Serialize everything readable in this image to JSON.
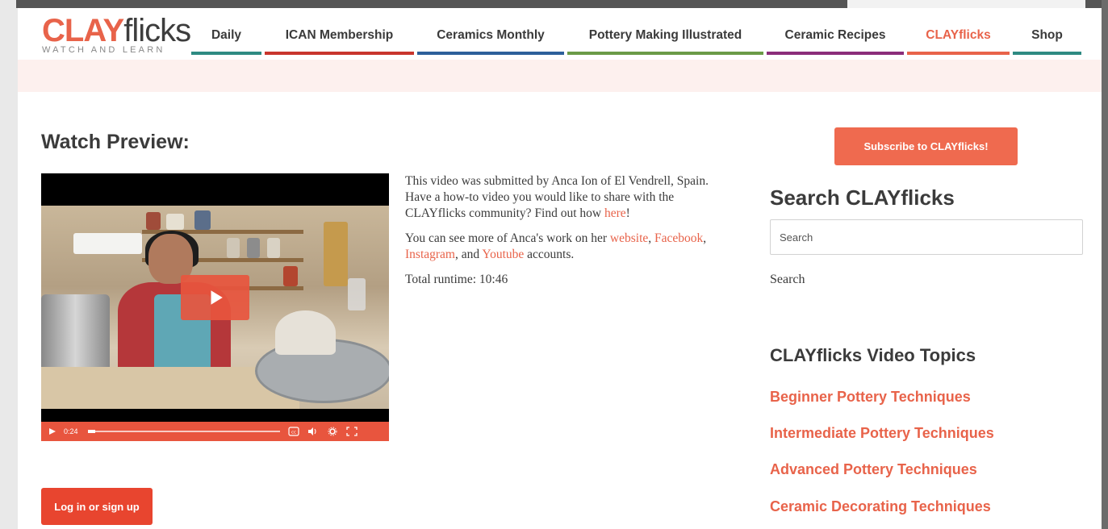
{
  "brand": {
    "logo_clay": "CLAY",
    "logo_flicks": "flicks",
    "logo_tagline": "WATCH AND LEARN",
    "accent": "#e8634a"
  },
  "nav": {
    "items": [
      {
        "label": "Daily",
        "color": "#2e8a82",
        "active": false
      },
      {
        "label": "ICAN Membership",
        "color": "#c8352c",
        "active": false
      },
      {
        "label": "Ceramics Monthly",
        "color": "#2d5f9a",
        "active": false
      },
      {
        "label": "Pottery Making Illustrated",
        "color": "#6b9a47",
        "active": false
      },
      {
        "label": "Ceramic Recipes",
        "color": "#8b2d7a",
        "active": false
      },
      {
        "label": "CLAYflicks",
        "color": "#e8634a",
        "active": true
      },
      {
        "label": "Shop",
        "color": "#2e8a82",
        "active": false
      }
    ]
  },
  "main": {
    "watch_title": "Watch Preview:",
    "video": {
      "current_time": "0:24",
      "progress_fraction": 0.04,
      "icons": [
        "play-icon",
        "closed-captions-icon",
        "volume-icon",
        "settings-icon",
        "fullscreen-icon"
      ]
    },
    "description": {
      "p1_text": "This video was submitted by Anca Ion of El Vendrell, Spain. Have a how-to video you would like to share with the CLAYflicks community? Find out how ",
      "p1_link": "here",
      "p1_end": "!",
      "p2_text": "You can see more of Anca's work on her ",
      "link_website": "website",
      "sep1": ", ",
      "link_facebook": "Facebook",
      "sep2": ", ",
      "link_instagram": "Instagram",
      "sep3": ", and ",
      "link_youtube": "Youtube",
      "p2_end": " accounts.",
      "runtime": "Total runtime: 10:46"
    },
    "login_label": "Log in or sign up"
  },
  "sidebar": {
    "subscribe_label": "Subscribe to CLAYflicks!",
    "search_title": "Search CLAYflicks",
    "search_placeholder": "Search",
    "search_label": "Search",
    "topics_title": "CLAYflicks Video Topics",
    "topics": [
      "Beginner Pottery Techniques",
      "Intermediate Pottery Techniques",
      "Advanced Pottery Techniques",
      "Ceramic Decorating Techniques"
    ]
  }
}
